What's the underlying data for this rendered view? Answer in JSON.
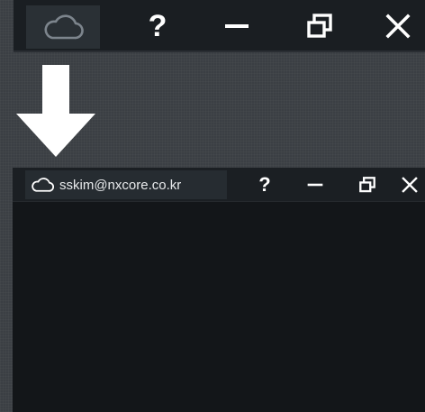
{
  "top_bar": {
    "cloud_icon": "cloud-icon",
    "help_label": "?",
    "minimize_icon": "minimize-icon",
    "restore_icon": "restore-icon",
    "close_icon": "close-icon"
  },
  "arrow_icon": "arrow-down-icon",
  "bottom_bar": {
    "cloud_icon": "cloud-icon",
    "account_email": "sskim@nxcore.co.kr",
    "help_label": "?",
    "minimize_icon": "minimize-icon",
    "restore_icon": "restore-icon",
    "close_icon": "close-icon"
  },
  "colors": {
    "background": "#3b3f44",
    "titlebar": "#1a1e22",
    "account_bg": "#262c31",
    "cloud_inactive": "#7d858d",
    "cloud_active": "#ffffff",
    "window_body": "#131619"
  }
}
